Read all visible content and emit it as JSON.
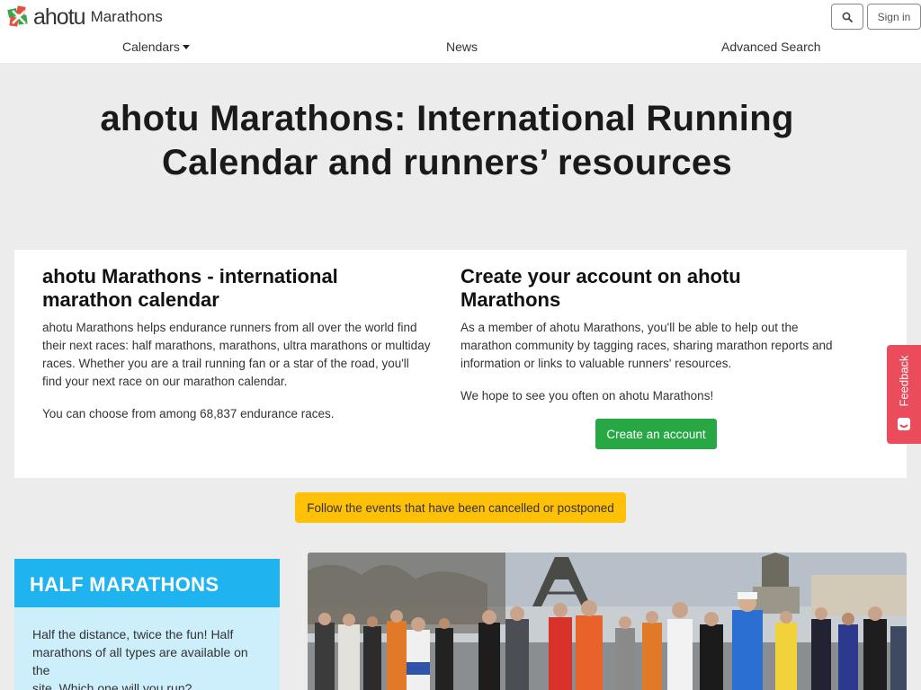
{
  "header": {
    "brand": "ahotu",
    "brand_sub": "Marathons",
    "signin_label": "Sign in",
    "nav": {
      "calendars": "Calendars",
      "news": "News",
      "advanced_search": "Advanced Search"
    }
  },
  "hero": {
    "title_line1": "ahotu Marathons: International Running",
    "title_line2": "Calendar and runners’ resources"
  },
  "intro": {
    "title_line1": "ahotu Marathons - international",
    "title_line2": "marathon calendar",
    "p1_lines": [
      "ahotu Marathons helps endurance runners from all over the world find",
      "their next races: half marathons, marathons, ultra marathons or multiday",
      "races. Whether you are a trail running fan or a star of the road, you'll",
      "find your next race on our marathon calendar."
    ],
    "p2": "You can choose from among 68,837 endurance races."
  },
  "account": {
    "title_line1": "Create your account on ahotu",
    "title_line2": "Marathons",
    "p1_lines": [
      "As a member of ahotu Marathons, you'll be able to help out the",
      "marathon community by tagging races, sharing marathon reports and",
      "information or links to valuable runners' resources."
    ],
    "p2": "We hope to see you often on ahotu Marathons!",
    "button_label": "Create an account"
  },
  "cancelled_button_label": "Follow the events that have been cancelled or postponed",
  "half_marathons": {
    "title": "HALF MARATHONS",
    "text_lines": [
      "Half the distance, twice the fun! Half",
      "marathons of all types are available on the",
      "site. Which one will you run?"
    ]
  },
  "feedback_label": "Feedback",
  "colors": {
    "green": "#28a745",
    "yellow": "#ffc107",
    "half_marathon_blue": "#1fb4ef",
    "feedback_red": "#ea4c5b"
  },
  "icons": {
    "logo": "ahotu-logo-icon",
    "search": "search-icon",
    "feedback": "feedback-face-icon"
  }
}
